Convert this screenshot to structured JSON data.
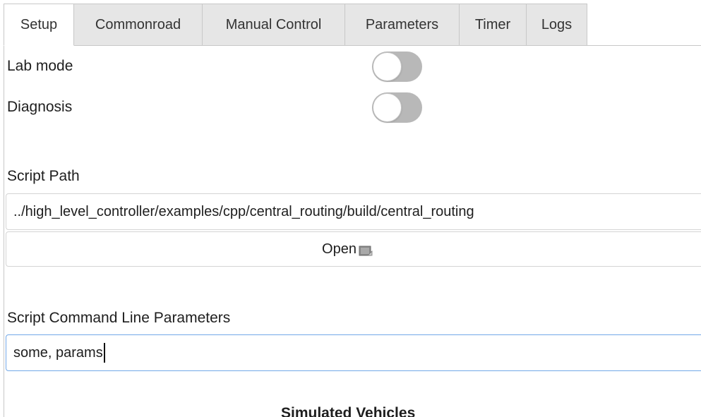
{
  "tabs": [
    {
      "label": "Setup",
      "active": true
    },
    {
      "label": "Commonroad",
      "active": false
    },
    {
      "label": "Manual Control",
      "active": false
    },
    {
      "label": "Parameters",
      "active": false
    },
    {
      "label": "Timer",
      "active": false
    },
    {
      "label": "Logs",
      "active": false
    }
  ],
  "toggles": {
    "lab_mode": {
      "label": "Lab mode",
      "on": false
    },
    "diagnosis": {
      "label": "Diagnosis",
      "on": false
    }
  },
  "script_path": {
    "label": "Script Path",
    "value": "../high_level_controller/examples/cpp/central_routing/build/central_routing",
    "open_button": "Open",
    "open_icon": "file-open-icon"
  },
  "script_params": {
    "label": "Script Command Line Parameters",
    "value": "some, params"
  },
  "next_section": {
    "label": "Simulated Vehicles"
  },
  "colors": {
    "tab_inactive": "#e6e6e6",
    "toggle_off": "#b8b8b8",
    "focus_border": "#72a8e8"
  }
}
